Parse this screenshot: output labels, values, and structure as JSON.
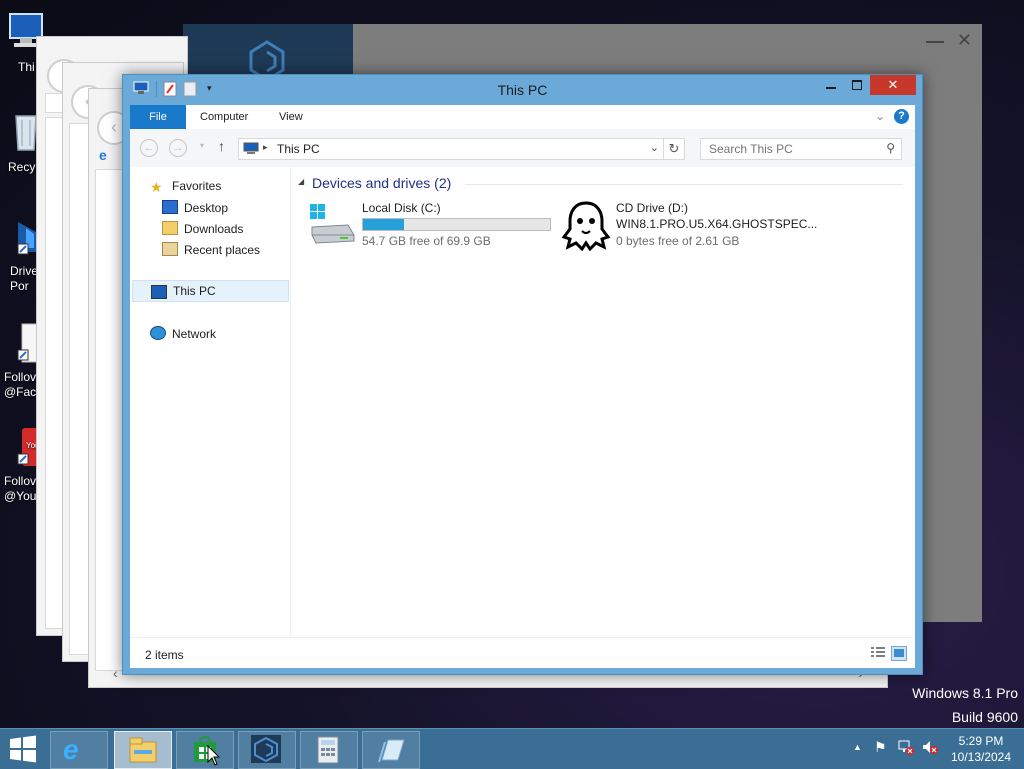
{
  "desktop": {
    "icons": [
      {
        "label": "Thi",
        "icon": "computer-icon"
      },
      {
        "label": "Recyc",
        "icon": "recycle-bin-icon"
      },
      {
        "label": "Drive\nPor",
        "icon": "driver-shortcut-icon"
      },
      {
        "label": "Follov\n@Face",
        "icon": "facebook-shortcut-icon"
      },
      {
        "label": "Follov\n@You",
        "icon": "youtube-shortcut-icon"
      }
    ],
    "watermark_line1": "Windows 8.1 Pro",
    "watermark_line2": "Build 9600"
  },
  "explorer": {
    "title": "This PC",
    "quick_access": [
      "computer-icon",
      "properties-icon",
      "new-folder-icon",
      "customize-qat-icon"
    ],
    "ribbon_tabs": [
      "File",
      "Computer",
      "View"
    ],
    "address_path": "This PC",
    "search_placeholder": "Search This PC",
    "nav": {
      "favorites": "Favorites",
      "desktop": "Desktop",
      "downloads": "Downloads",
      "recent": "Recent places",
      "this_pc": "This PC",
      "network": "Network"
    },
    "section_title": "Devices and drives (2)",
    "drives": [
      {
        "name": "Local Disk (C:)",
        "free_text": "54.7 GB free of 69.9 GB",
        "used_fraction": 0.217
      },
      {
        "name": "CD Drive (D:)",
        "volume": "WIN8.1.PRO.U5.X64.GHOSTSPEC...",
        "free_text": "0 bytes free of 2.61 GB"
      }
    ],
    "status_items": "2 items"
  },
  "taskbar": {
    "clock_time": "5:29 PM",
    "clock_date": "10/13/2024"
  },
  "colors": {
    "accent": "#1979ca",
    "window_frame": "#6aa9d8",
    "taskbar": "#3a6e95",
    "drive_bar": "#26a0da"
  }
}
